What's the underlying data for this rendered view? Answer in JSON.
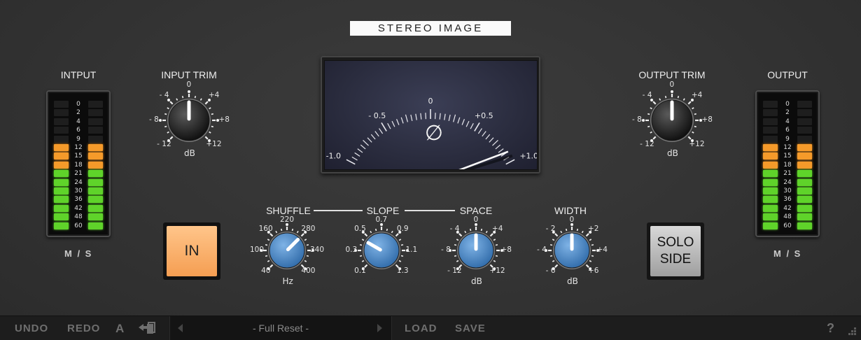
{
  "title": "STEREO IMAGE",
  "input_meter": {
    "label": "INTPUT",
    "mode": "M / S",
    "scale": [
      "0",
      "2",
      "4",
      "6",
      "9",
      "12",
      "15",
      "18",
      "21",
      "24",
      "30",
      "36",
      "42",
      "48",
      "60"
    ],
    "lit_segments": 10
  },
  "output_meter": {
    "label": "OUTPUT",
    "mode": "M / S",
    "scale": [
      "0",
      "2",
      "4",
      "6",
      "9",
      "12",
      "15",
      "18",
      "21",
      "24",
      "30",
      "36",
      "42",
      "48",
      "60"
    ],
    "lit_segments": 10
  },
  "input_trim": {
    "label": "INPUT TRIM",
    "unit": "dB",
    "scale": [
      "- 12",
      "- 8",
      "- 4",
      "0",
      "+4",
      "+8",
      "+12"
    ],
    "value_db": 0
  },
  "output_trim": {
    "label": "OUTPUT TRIM",
    "unit": "dB",
    "scale": [
      "- 12",
      "- 8",
      "- 4",
      "0",
      "+4",
      "+8",
      "+12"
    ],
    "value_db": 0
  },
  "vu": {
    "labels": [
      "-1.0",
      "- 0.5",
      "0",
      "+0.5",
      "+1.0"
    ],
    "symbol": "∅",
    "needle_value": 0.9
  },
  "shuffle": {
    "label": "SHUFFLE",
    "unit": "Hz",
    "scale": [
      "40",
      "100",
      "160",
      "220",
      "280",
      "340",
      "400"
    ],
    "value": 280
  },
  "slope": {
    "label": "SLOPE",
    "scale": [
      "0.1",
      "0.3",
      "0.5",
      "0.7",
      "0.9",
      "1.1",
      "1.3"
    ],
    "value": 0.4
  },
  "space": {
    "label": "SPACE",
    "unit": "dB",
    "scale": [
      "- 12",
      "- 8",
      "- 4",
      "0",
      "+4",
      "+8",
      "+12"
    ],
    "value": 0
  },
  "width": {
    "label": "WIDTH",
    "unit": "dB",
    "scale": [
      "- 6",
      "- 4",
      "- 2",
      "0",
      "+2",
      "+4",
      "+6"
    ],
    "value": 0
  },
  "in_button": {
    "label": "IN"
  },
  "solo_button": {
    "line1": "SOLO",
    "line2": "SIDE"
  },
  "toolbar": {
    "undo": "UNDO",
    "redo": "REDO",
    "ab": "A",
    "preset": "- Full Reset -",
    "load": "LOAD",
    "save": "SAVE",
    "help": "?"
  },
  "colors": {
    "meter_orange": "#f59a2a",
    "meter_green": "#5fd32a",
    "in_button": "#f9b370",
    "knob_blue": "#4a86c6"
  }
}
